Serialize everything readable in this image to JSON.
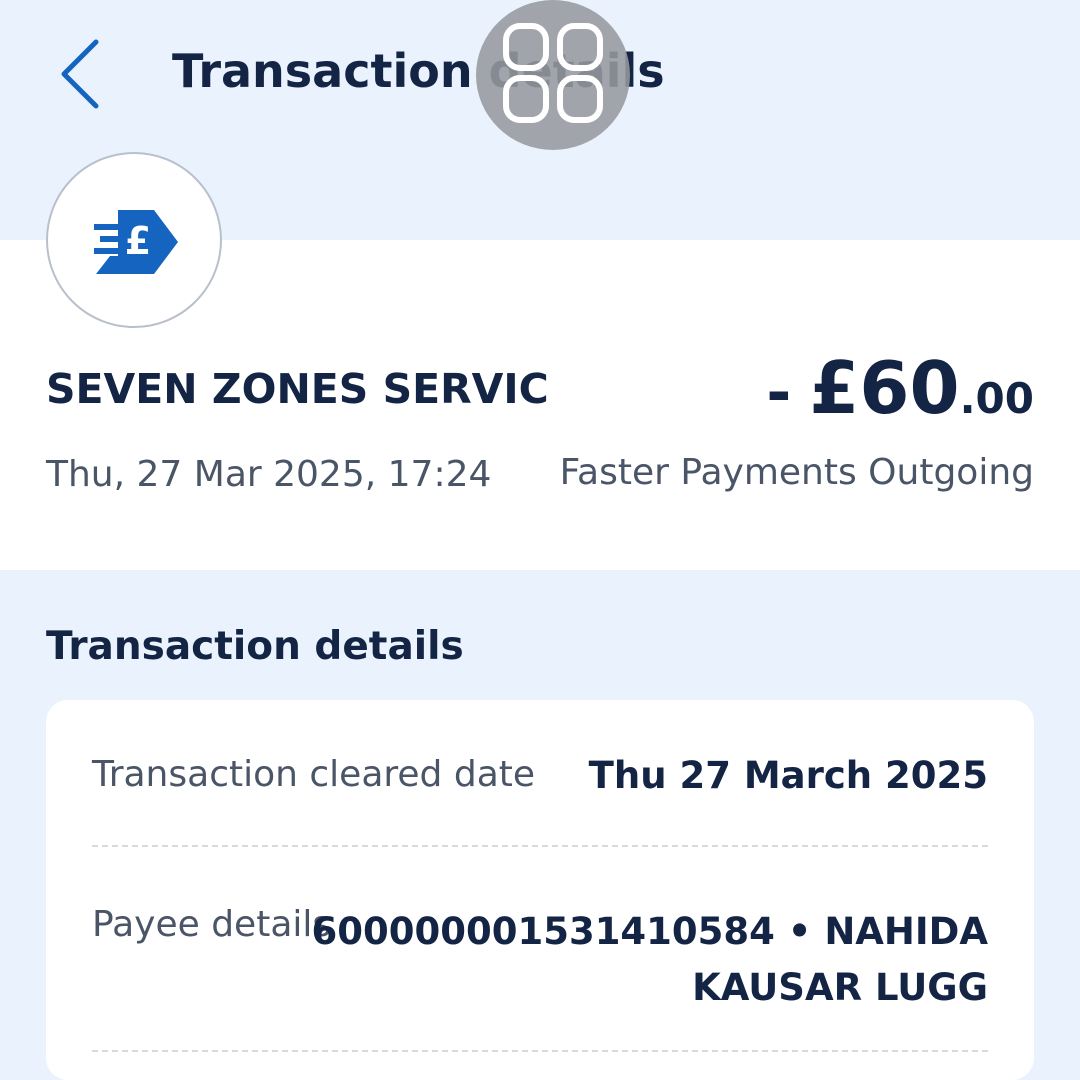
{
  "header": {
    "title": "Transaction details",
    "back_icon": "chevron-left-icon",
    "overlay_icon": "screen-overlay-icon"
  },
  "colors": {
    "brand_blue": "#1565c0",
    "text_dark": "#132444",
    "text_muted": "#4a5567",
    "header_bg": "#eaf3fd",
    "card_bg": "#ffffff"
  },
  "summary": {
    "logo_icon": "faster-payment-pound-icon",
    "merchant": "SEVEN ZONES SERVIC",
    "amount_sign": "-",
    "amount_major": "£60",
    "amount_minor": ".00",
    "datetime": "Thu, 27 Mar 2025, 17:24",
    "type": "Faster Payments Outgoing"
  },
  "details": {
    "heading": "Transaction details",
    "rows": [
      {
        "label": "Transaction cleared date",
        "value": "Thu 27 March 2025"
      },
      {
        "label": "Payee details",
        "value_line1": "600000001531410584 • NAHIDA",
        "value_line2": "KAUSAR LUGG"
      }
    ]
  }
}
